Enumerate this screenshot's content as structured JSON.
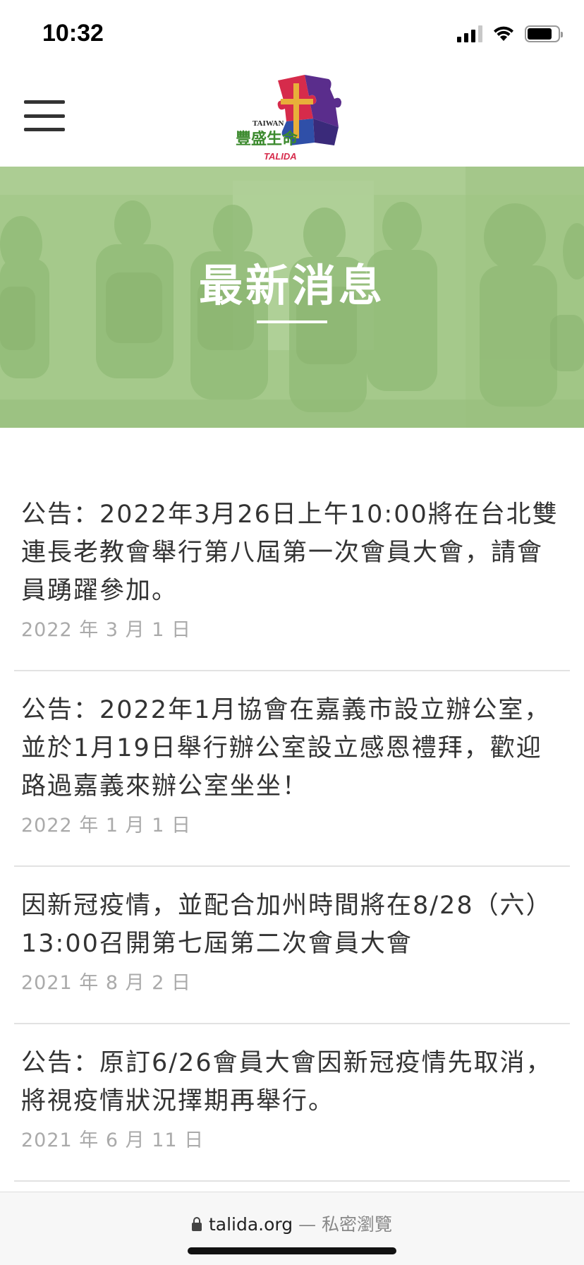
{
  "status_bar": {
    "time": "10:32",
    "battery_percent": 80
  },
  "header": {
    "menu_icon": "hamburger-menu-icon",
    "logo": {
      "text_taiwan": "TAIWAN",
      "text_chinese": "豐盛生命",
      "text_talida": "TALIDA"
    }
  },
  "banner": {
    "title": "最新消息"
  },
  "news": [
    {
      "title": "公告：2022年3月26日上午10:00將在台北雙連長老教會舉行第八屆第一次會員大會，請會員踴躍參加。",
      "date": "2022 年 3 月 1 日"
    },
    {
      "title": "公告：2022年1月協會在嘉義市設立辦公室，並於1月19日舉行辦公室設立感恩禮拜，歡迎路過嘉義來辦公室坐坐！",
      "date": "2022 年 1 月 1 日"
    },
    {
      "title": "因新冠疫情，並配合加州時間將在8/28（六）13:00召開第七屆第二次會員大會",
      "date": "2021 年 8 月 2 日"
    },
    {
      "title": "公告：原訂6/26會員大會因新冠疫情先取消，將視疫情狀況擇期再舉行。",
      "date": "2021 年 6 月 11 日"
    }
  ],
  "browser": {
    "domain": "talida.org",
    "separator": "—",
    "mode": "私密瀏覽"
  }
}
